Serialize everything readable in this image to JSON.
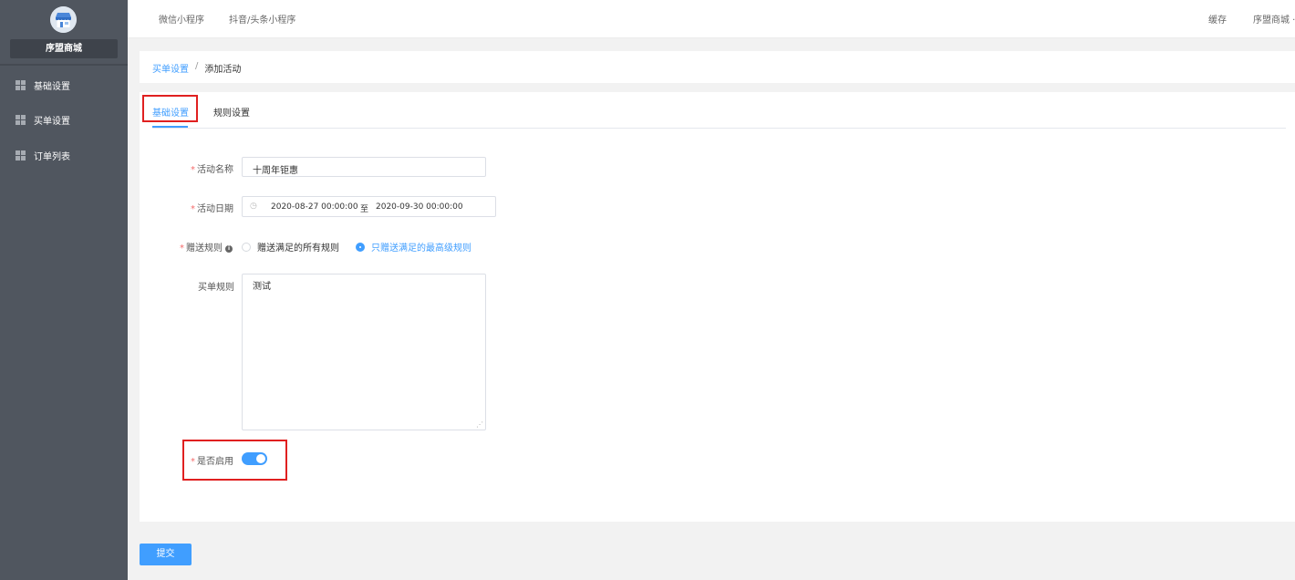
{
  "sidebar": {
    "shop_name": "序盟商城",
    "items": [
      {
        "label": "基础设置"
      },
      {
        "label": "买单设置"
      },
      {
        "label": "订单列表"
      }
    ]
  },
  "topbar": {
    "tabs": [
      {
        "label": "微信小程序"
      },
      {
        "label": "抖音/头条小程序"
      }
    ],
    "cache_label": "缓存",
    "user_label": "序盟商城 ·"
  },
  "breadcrumb": {
    "parent": "买单设置",
    "separator": "/",
    "current": "添加活动"
  },
  "tabs": [
    {
      "label": "基础设置",
      "active": true
    },
    {
      "label": "规则设置",
      "active": false
    }
  ],
  "form": {
    "activity_name": {
      "label": "活动名称",
      "value": "十周年钜惠"
    },
    "activity_date": {
      "label": "活动日期",
      "start": "2020-08-27 00:00:00",
      "separator": "至",
      "end": "2020-09-30 00:00:00"
    },
    "gift_rule": {
      "label": "赠送规则",
      "options": [
        {
          "label": "赠送满足的所有规则",
          "checked": false
        },
        {
          "label": "只赠送满足的最高级规则",
          "checked": true
        }
      ]
    },
    "bill_rule": {
      "label": "买单规则",
      "value": "测试"
    },
    "enabled": {
      "label": "是否启用",
      "on": true
    }
  },
  "submit_label": "提交",
  "colors": {
    "primary": "#409eff",
    "sidebar_bg": "#50565f",
    "highlight_red": "#e02020"
  }
}
